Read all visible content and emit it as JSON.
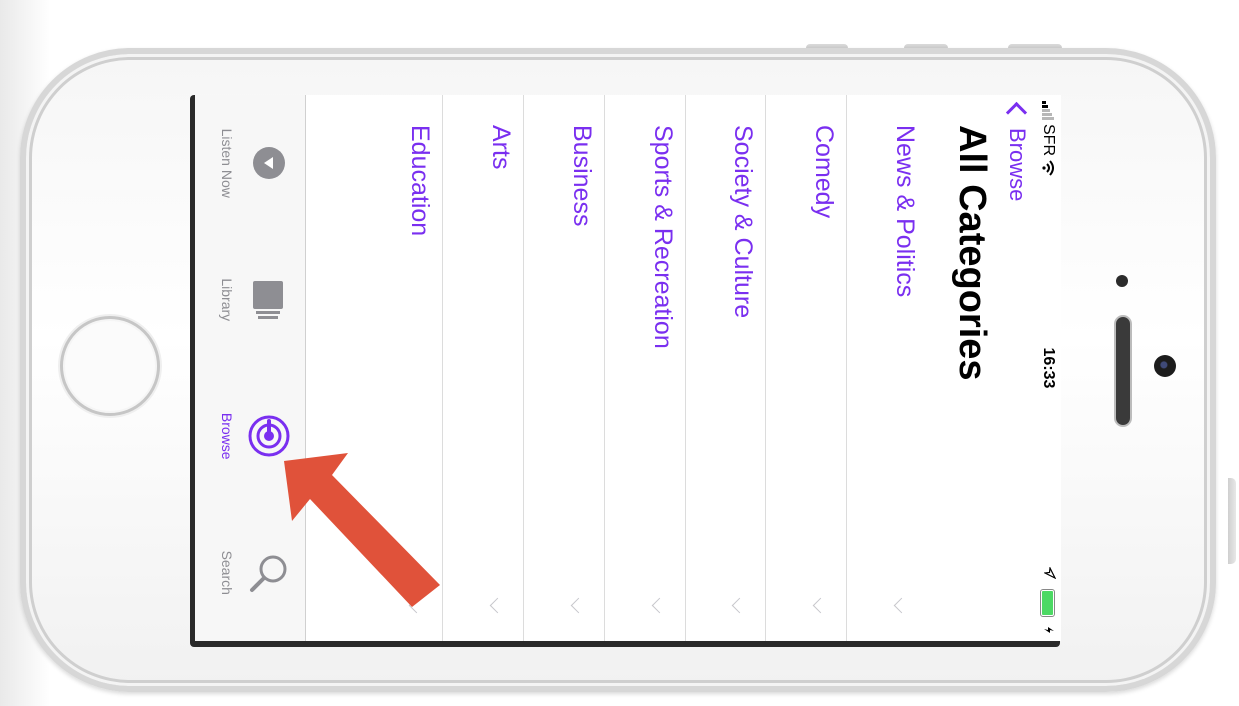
{
  "status_bar": {
    "carrier": "SFR",
    "time": "16:33"
  },
  "nav": {
    "back_label": "Browse"
  },
  "page": {
    "title": "All Categories"
  },
  "categories": [
    {
      "label": "News & Politics"
    },
    {
      "label": "Comedy"
    },
    {
      "label": "Society & Culture"
    },
    {
      "label": "Sports & Recreation"
    },
    {
      "label": "Business"
    },
    {
      "label": "Arts"
    },
    {
      "label": "Education"
    }
  ],
  "tab_bar": {
    "tabs": [
      {
        "label": "Listen Now",
        "icon": "play-circle-icon"
      },
      {
        "label": "Library",
        "icon": "library-icon"
      },
      {
        "label": "Browse",
        "icon": "podcast-icon",
        "active": true
      },
      {
        "label": "Search",
        "icon": "search-icon"
      }
    ]
  },
  "colors": {
    "accent": "#7a2ff0",
    "annotation_arrow": "#e0523a",
    "battery": "#4cd964"
  }
}
